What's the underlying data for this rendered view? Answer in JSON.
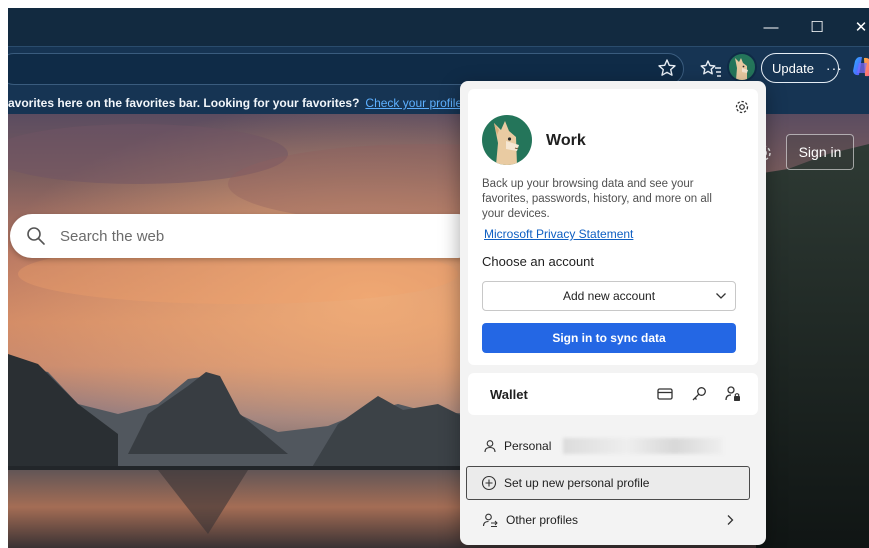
{
  "window": {
    "minimize_glyph": "—",
    "maximize_glyph": "☐",
    "close_glyph": "✕"
  },
  "toolbar": {
    "update_label": "Update",
    "more_glyph": "···",
    "icons": [
      "star-icon",
      "favorites-icon",
      "profile-avatar",
      "copilot-icon"
    ]
  },
  "favorites_bar": {
    "message": "avorites here on the favorites bar. Looking for your favorites?",
    "link_text": "Check your profiles"
  },
  "page": {
    "search_placeholder": "Search the web",
    "sign_in_label": "Sign in"
  },
  "profile_flyout": {
    "profile_name": "Work",
    "backup_text": "Back up your browsing data and see your favorites, passwords, history, and more on all your devices.",
    "privacy_link": "Microsoft Privacy Statement",
    "choose_account_label": "Choose an account",
    "account_select_value": "Add new account",
    "sync_button": "Sign in to sync data",
    "wallet_label": "Wallet",
    "personal_label": "Personal",
    "setup_profile_label": "Set up new personal profile",
    "other_profiles_label": "Other profiles"
  },
  "colors": {
    "titlebar": "#122a40",
    "toolbar": "#163453",
    "accent_button": "#2467e4",
    "link": "#0f5fc2",
    "avatar_bg": "#24755a"
  }
}
